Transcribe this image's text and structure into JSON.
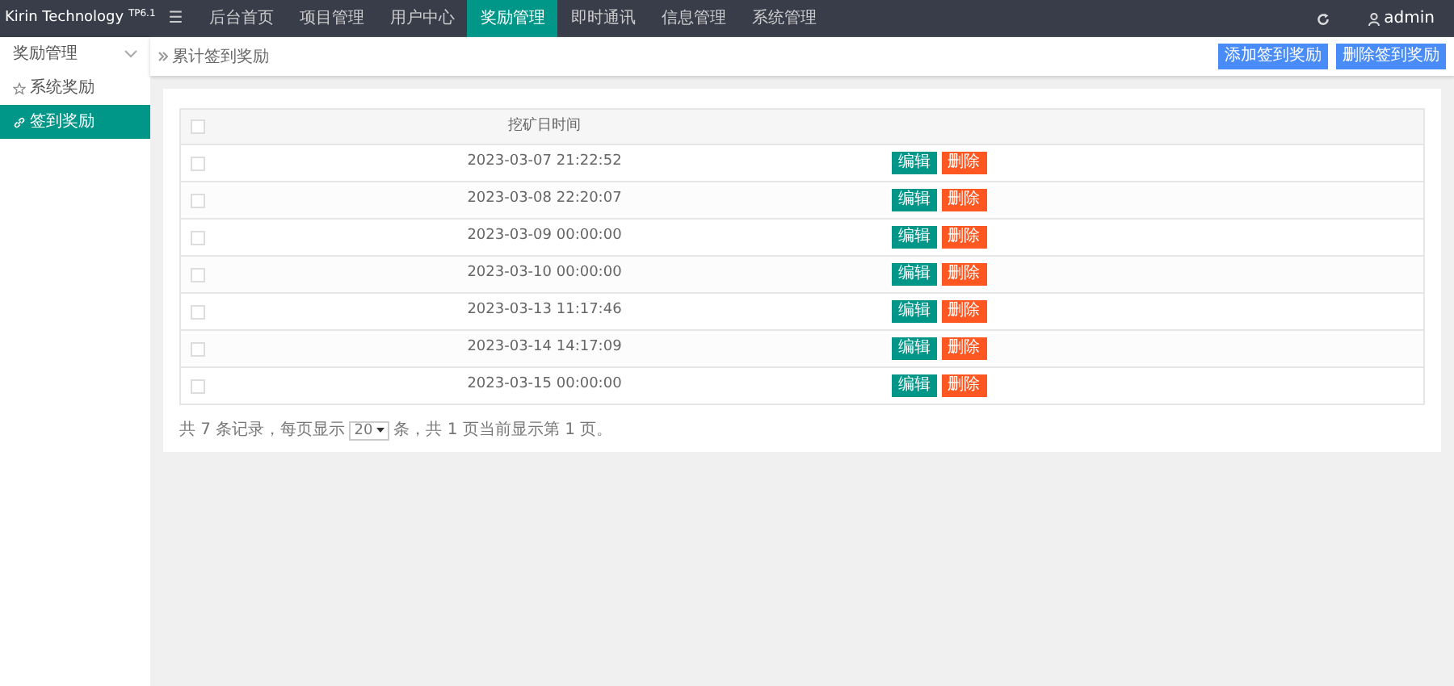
{
  "brand": {
    "name": "Kirin Technology",
    "version": "TP6.1"
  },
  "menu_toggle": "☰",
  "top_nav": [
    {
      "label": "后台首页",
      "selected": false
    },
    {
      "label": "项目管理",
      "selected": false
    },
    {
      "label": "用户中心",
      "selected": false
    },
    {
      "label": "奖励管理",
      "selected": true
    },
    {
      "label": "即时通讯",
      "selected": false
    },
    {
      "label": "信息管理",
      "selected": false
    },
    {
      "label": "系统管理",
      "selected": false
    }
  ],
  "user": {
    "name": "admin"
  },
  "sidebar": {
    "group": {
      "label": "奖励管理",
      "expanded": true,
      "children": [
        {
          "label": "系统奖励",
          "selected": false
        },
        {
          "label": "签到奖励",
          "selected": true
        }
      ]
    }
  },
  "breadcrumb": "累计签到奖励",
  "actions": [
    "添加签到奖励",
    "删除签到奖励"
  ],
  "table": {
    "all_checked": false,
    "columns": [
      "挖矿日时间"
    ],
    "rows": [
      {
        "time": "2023-03-07 21:22:52",
        "checked": false,
        "actions": [
          "编辑",
          "删除"
        ]
      },
      {
        "time": "2023-03-08 22:20:07",
        "checked": false,
        "actions": [
          "编辑",
          "删除"
        ]
      },
      {
        "time": "2023-03-09 00:00:00",
        "checked": false,
        "actions": [
          "编辑",
          "删除"
        ]
      },
      {
        "time": "2023-03-10 00:00:00",
        "checked": false,
        "actions": [
          "编辑",
          "删除"
        ]
      },
      {
        "time": "2023-03-13 11:17:46",
        "checked": false,
        "actions": [
          "编辑",
          "删除"
        ]
      },
      {
        "time": "2023-03-14 14:17:09",
        "checked": false,
        "actions": [
          "编辑",
          "删除"
        ]
      },
      {
        "time": "2023-03-15 00:00:00",
        "checked": false,
        "actions": [
          "编辑",
          "删除"
        ]
      }
    ]
  },
  "pagination": {
    "before": "共 7 条记录，每页显示",
    "page_size": "20",
    "after": "条，共 1 页当前显示第 1 页。"
  }
}
